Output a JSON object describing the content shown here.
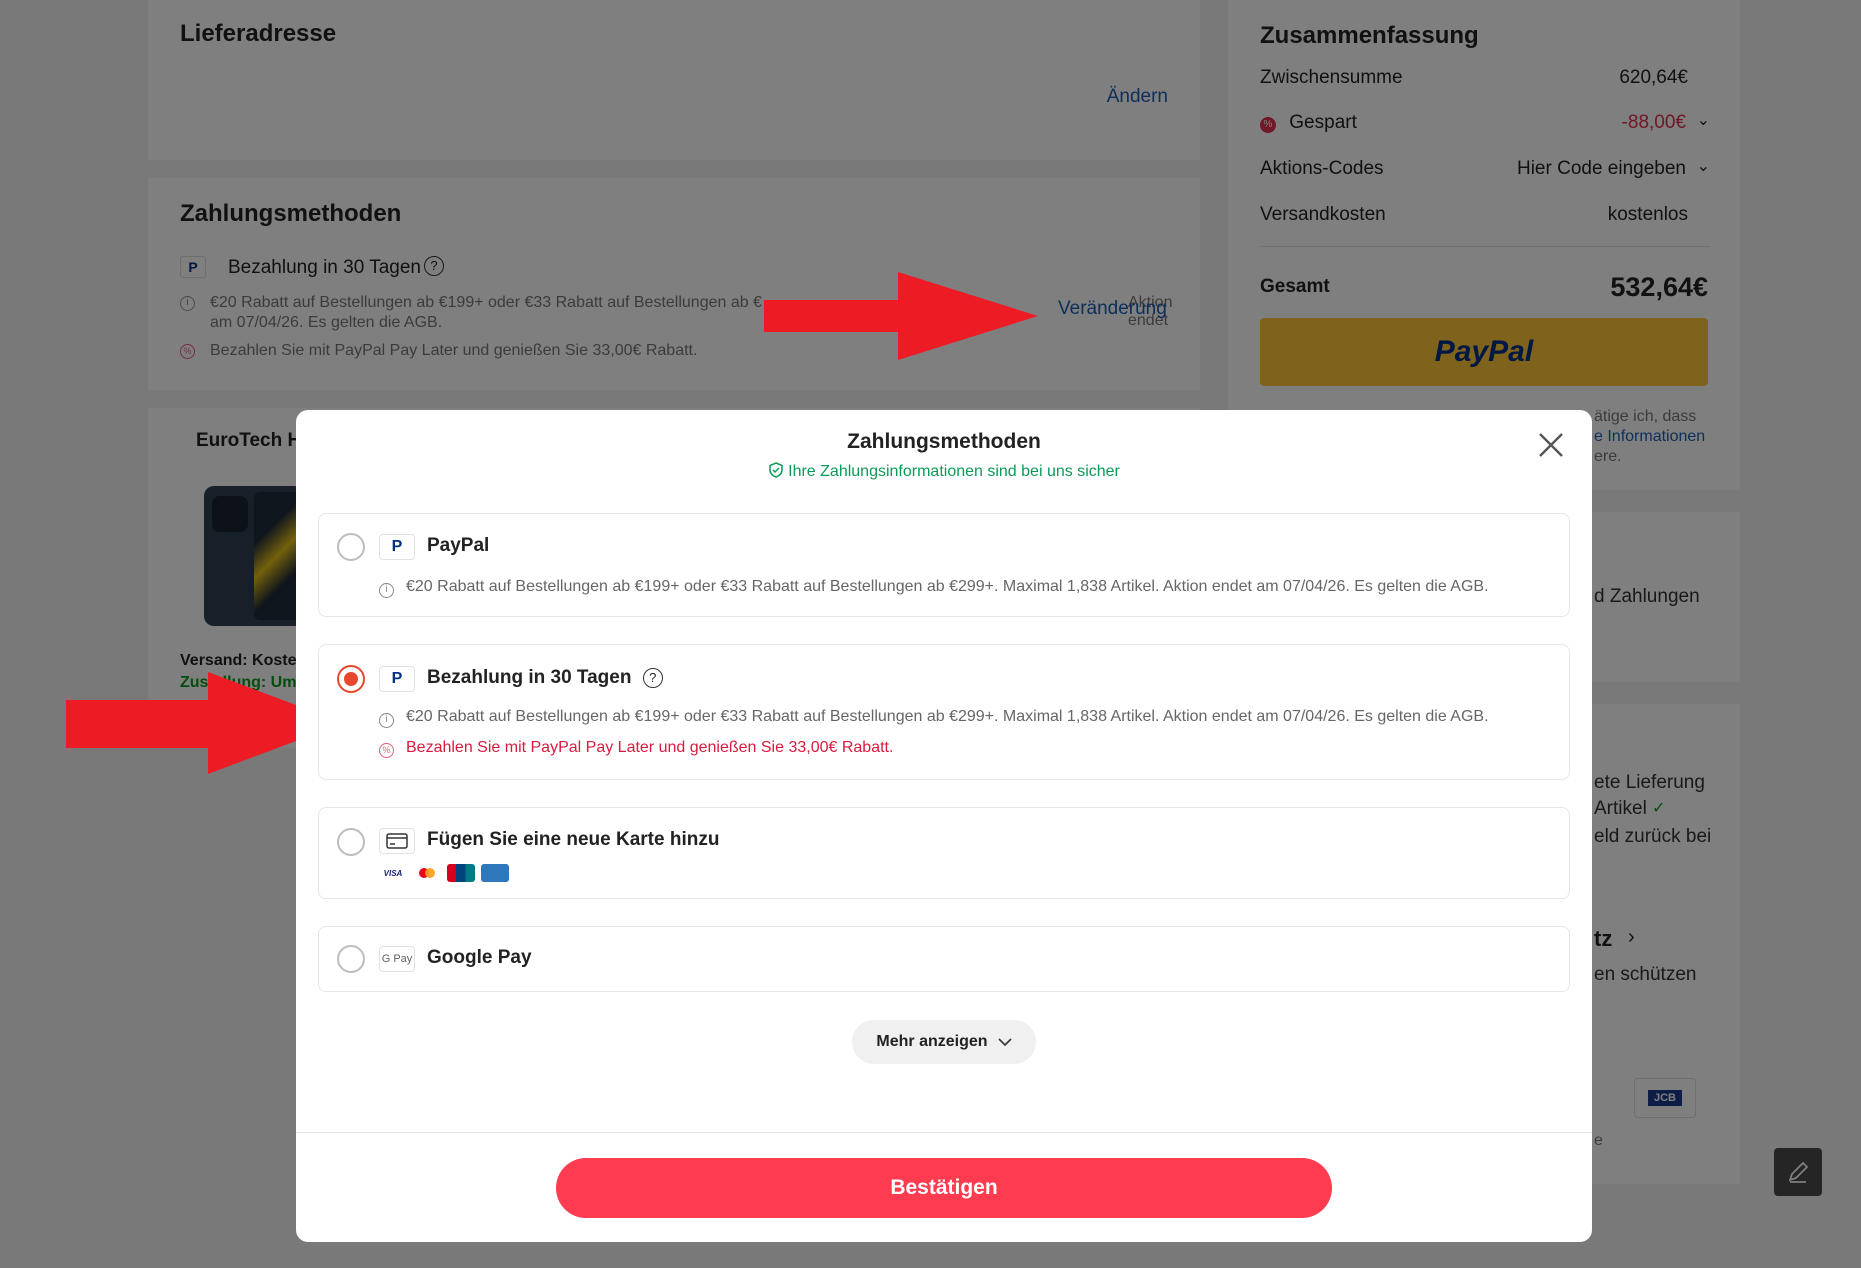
{
  "delivery": {
    "title": "Lieferadresse",
    "change_link": "Ändern"
  },
  "payment_section": {
    "title": "Zahlungsmethoden",
    "selected_method": "Bezahlung in 30 Tagen",
    "info_text_1": "€20 Rabatt auf Bestellungen ab €199+ oder €33 Rabatt auf Bestellungen ab €",
    "info_text_2": "Aktion endet",
    "info_text_3": "am 07/04/26. Es gelten die AGB.",
    "promo_text": "Bezahlen Sie mit PayPal Pay Later und genießen Sie 33,00€ Rabatt.",
    "change_link": "Veränderung"
  },
  "product_card": {
    "seller": "EuroTech H",
    "shipping": "Versand: Koster",
    "delivery": "Zustellung: Um"
  },
  "summary": {
    "title": "Zusammenfassung",
    "subtotal_label": "Zwischensumme",
    "subtotal_value": "620,64€",
    "saved_label": "Gespart",
    "saved_value": "-88,00€",
    "codes_label": "Aktions-Codes",
    "codes_value": "Hier Code eingeben",
    "shipping_label": "Versandkosten",
    "shipping_value": "kostenlos",
    "total_label": "Gesamt",
    "total_value": "532,64€",
    "paypal_button": "PayPal",
    "legal_1": "ätige ich, dass",
    "legal_2": "e Informationen",
    "legal_3": "ere."
  },
  "right_partial": {
    "text_1": "d Zahlungen",
    "text_2": "ete Lieferung",
    "text_3": "Artikel",
    "text_4": "eld zurück bei",
    "text_5": "tz",
    "text_6": "en schützen",
    "text_7": "e",
    "badge_jcb": "JCB"
  },
  "modal": {
    "title": "Zahlungsmethoden",
    "secure_text": "Ihre Zahlungsinformationen sind bei uns sicher",
    "options": [
      {
        "label": "PayPal",
        "info": "€20 Rabatt auf Bestellungen ab €199+ oder €33 Rabatt auf Bestellungen ab €299+. Maximal 1,838 Artikel. Aktion endet am 07/04/26. Es gelten die AGB."
      },
      {
        "label": "Bezahlung in 30 Tagen",
        "info": "€20 Rabatt auf Bestellungen ab €199+ oder €33 Rabatt auf Bestellungen ab €299+. Maximal 1,838 Artikel. Aktion endet am 07/04/26. Es gelten die AGB.",
        "promo": "Bezahlen Sie mit PayPal Pay Later und genießen Sie 33,00€ Rabatt."
      },
      {
        "label": "Fügen Sie eine neue Karte hinzu",
        "card_logos": [
          "VISA",
          "MC",
          "UP",
          "AMEX"
        ]
      },
      {
        "label": "Google Pay",
        "icon_text": "G Pay"
      }
    ],
    "more_button": "Mehr anzeigen",
    "confirm_button": "Bestätigen"
  },
  "colors": {
    "accent_red": "#ff3b50",
    "radio_selected": "#e8472d",
    "promo_red": "#d81b3e",
    "secure_green": "#0a9b56",
    "paypal_yellow": "#ffc439",
    "arrow_red": "#ed1c24"
  }
}
